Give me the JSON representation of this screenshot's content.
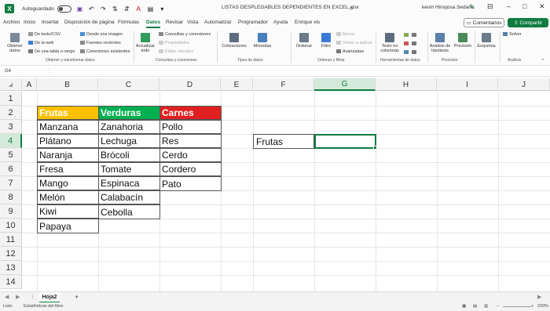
{
  "titlebar": {
    "autosave_label": "Autoguardado",
    "doc_title": "LISTAS DESPLEGABLES DEPENDIENTES EN EXCEL.xlsx",
    "user": "kevin Hinojosa Sedano"
  },
  "menu": {
    "tabs": [
      "Archivo",
      "Inicio",
      "Insertar",
      "Disposición de página",
      "Fórmulas",
      "Datos",
      "Revisar",
      "Vista",
      "Automatizar",
      "Programador",
      "Ayuda",
      "Enrique xls"
    ],
    "active": "Datos",
    "comments_label": "Comentarios",
    "share_label": "Compartir"
  },
  "ribbon": {
    "get_data_label": "Obtener datos",
    "from_text_csv": "De texto/CSV",
    "from_web": "De la web",
    "from_table": "De una tabla o rango",
    "from_image": "Desde una imagen",
    "recent_sources": "Fuentes recientes",
    "existing_connections": "Conexiones existentes",
    "group_get_transform": "Obtener y transformar datos",
    "refresh_all": "Actualizar todo",
    "queries_connections": "Consultas y conexiones",
    "properties": "Propiedades",
    "edit_links": "Editar vínculos",
    "group_queries": "Consultas y conexiones",
    "stocks": "Cotizaciones",
    "currencies": "Monedas",
    "group_data_types": "Tipos de datos",
    "sort": "Ordenar",
    "filter": "Filtro",
    "clear": "Borrar",
    "reapply": "Volver a aplicar",
    "advanced": "Avanzadas",
    "group_sort_filter": "Ordenar y filtrar",
    "text_to_columns": "Texto en columnas",
    "group_data_tools": "Herramientas de datos",
    "what_if": "Análisis de hipótesis",
    "forecast_sheet": "Previsión",
    "group_forecast": "Previsión",
    "outline": "Esquema",
    "solver": "Solver",
    "group_analysis": "Análisis"
  },
  "formula_bar": {
    "name_box": "G4"
  },
  "grid": {
    "columns": [
      "A",
      "B",
      "C",
      "D",
      "E",
      "F",
      "G",
      "H",
      "I",
      "J"
    ],
    "rows": [
      "1",
      "2",
      "3",
      "4",
      "5",
      "6",
      "7",
      "8",
      "9",
      "10",
      "11",
      "12",
      "13",
      "14"
    ],
    "selected_column": "G",
    "selected_row": "4"
  },
  "table": {
    "headers": [
      "Frutas",
      "Verduras",
      "Carnes"
    ],
    "header_colors": [
      "#ffc000",
      "#00b050",
      "#e02020"
    ],
    "frutas": [
      "Manzana",
      "Plátano",
      "Naranja",
      "Fresa",
      "Mango",
      "Melón",
      "Kiwi",
      "Papaya"
    ],
    "verduras": [
      "Zanahoria",
      "Lechuga",
      "Brócoli",
      "Tomate",
      "Espinaca",
      "Calabacín",
      "Cebolla"
    ],
    "carnes": [
      "Pollo",
      "Res",
      "Cerdo",
      "Cordero",
      "Pato"
    ]
  },
  "lookup": {
    "label": "Frutas",
    "value": ""
  },
  "sheets": {
    "active": "Hoja2"
  },
  "status": {
    "left": "Listo",
    "stats": "Estadísticas del libro",
    "zoom": "220%"
  },
  "colors": {
    "accent": "#107c41"
  }
}
